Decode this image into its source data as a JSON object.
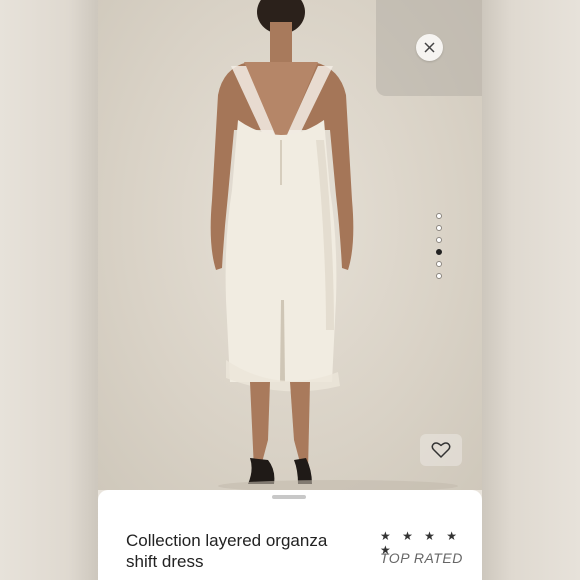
{
  "product": {
    "title": "Collection layered organza shift dress",
    "stars": "★ ★ ★ ★ ★",
    "rating_label": "TOP RATED"
  },
  "gallery": {
    "image_count": 6,
    "active_index": 3,
    "close_icon": "close-icon",
    "favorite_icon": "heart-icon"
  },
  "colors": {
    "background": "#e9e4dc",
    "dress": "#f1ece1",
    "sheet": "#ffffff"
  }
}
